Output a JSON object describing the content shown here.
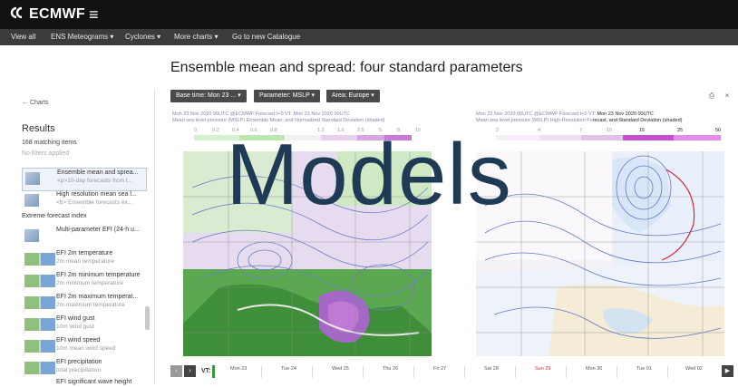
{
  "header": {
    "logo_text": "ECMWF",
    "menu_icon": "hamburger-icon",
    "nav": [
      "View all",
      "ENS Meteograms ▾",
      "Cyclones ▾",
      "More charts ▾",
      "Go to new Catalogue"
    ]
  },
  "page": {
    "title": "Ensemble mean and spread: four standard parameters"
  },
  "sidebar": {
    "back_label": "← Charts",
    "results_label": "Results",
    "count_label": "168 matching items",
    "filters_label": "No filters applied",
    "items": [
      {
        "title": "Ensemble mean and sprea...",
        "subtitle": "<p>10-day forecasts from t..."
      },
      {
        "title": "High resolution mean sea l...",
        "subtitle": "<b> Ensemble forecasts ex..."
      }
    ],
    "group_label": "Extreme forecast index",
    "efi_items": [
      {
        "title": "Multi-parameter EFI (24-h u...",
        "subtitle": ""
      },
      {
        "title": "EFI 2m temperature",
        "subtitle": "2m mean temperature"
      },
      {
        "title": "EFI 2m minimum temperature",
        "subtitle": "2m minimum temperature"
      },
      {
        "title": "EFI 2m maximum temperat...",
        "subtitle": "2m maximum temperature"
      },
      {
        "title": "EFI wind gust",
        "subtitle": "10m wind gust"
      },
      {
        "title": "EFI wind speed",
        "subtitle": "10m mean wind speed"
      },
      {
        "title": "EFI precipitation",
        "subtitle": "total precipitation"
      },
      {
        "title": "EFI significant wave height",
        "subtitle": ""
      }
    ]
  },
  "toolbar": {
    "base_time": "Base time: Mon 23 ... ▾",
    "parameter": "Parameter: MSLP ▾",
    "area": "Area: Europe ▾",
    "print_icon": "print-icon",
    "close_icon": "close-icon"
  },
  "panels": {
    "left": {
      "line1": "Mon 23 Nov 2020 00UTC @ECMWF Forecast t+0 VT: Mon 23 Nov 2020 00UTC",
      "line2": "Mean sea level pressure (MSLP) Ensemble Mean, and Normalized Standard Deviation (shaded)",
      "ticks": [
        "0",
        "0.2",
        "0.4",
        "0.6",
        "0.8",
        "1.2",
        "1.6",
        "2.5",
        "5",
        "8",
        "15"
      ],
      "colors": [
        "#d8f0d0",
        "#bfe6b1",
        "#f2f2f2",
        "#ead0ef",
        "#d7a7e2",
        "#c47dd5",
        "#a355be"
      ]
    },
    "right": {
      "line1a": "Mon 23 Nov 2020 00UTC @ECMWF Forecast t+0 VT:",
      "line1b": "Mon 23 Nov 2020 00UTC",
      "line2a": "Mean sea level pressure (MSLP) High-Resolution Fo",
      "line2b": "recast, and Standard Deviation (shaded)",
      "ticks": [
        "2",
        "4",
        "7",
        "10",
        "15",
        "25",
        "50"
      ],
      "colors": [
        "#f7eff8",
        "#efdff2",
        "#e4c2ea",
        "#c94fd0",
        "#e28ee6"
      ]
    }
  },
  "watermark_text": "Models",
  "timeline": {
    "vt_label": "VT:",
    "prev_icon": "chevron-left-icon",
    "next_icon": "chevron-right-icon",
    "play_icon": "play-icon",
    "days": [
      "Mon 23",
      "Tue 24",
      "Wed 25",
      "Thu 26",
      "Fri 27",
      "Sat 28",
      "Sun 29",
      "Mon 30",
      "Tue 01",
      "Wed 02"
    ],
    "highlight_day": "Sun 29",
    "highlight_color": "#d22"
  }
}
